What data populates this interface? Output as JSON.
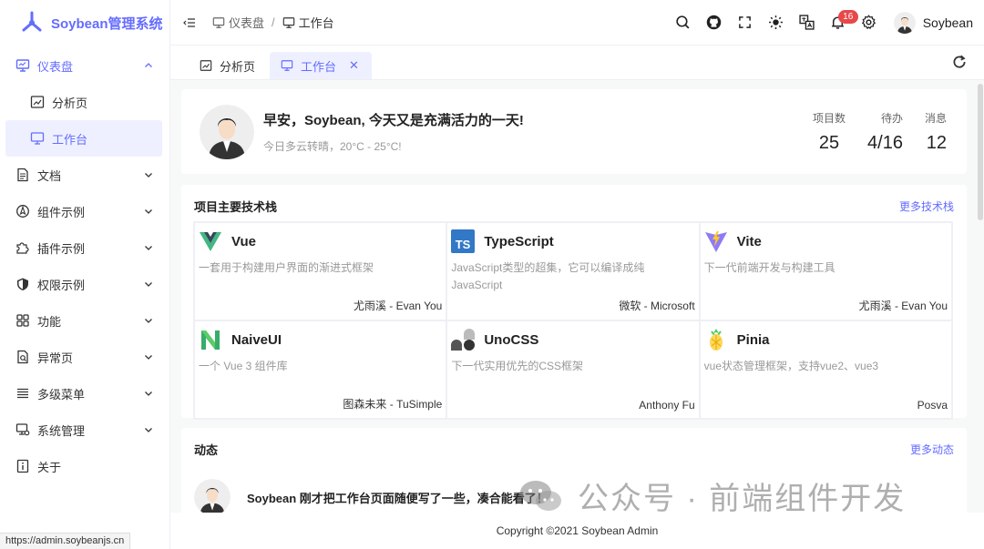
{
  "app": {
    "title": "Soybean管理系统",
    "status_url": "https://admin.soybeanjs.cn"
  },
  "sidebar": {
    "items": [
      {
        "label": "仪表盘",
        "icon": "monitor-icon"
      },
      {
        "label": "文档",
        "icon": "document-icon"
      },
      {
        "label": "组件示例",
        "icon": "compass-icon"
      },
      {
        "label": "插件示例",
        "icon": "plugin-icon"
      },
      {
        "label": "权限示例",
        "icon": "shield-icon"
      },
      {
        "label": "功能",
        "icon": "grid-icon"
      },
      {
        "label": "异常页",
        "icon": "error-page-icon"
      },
      {
        "label": "多级菜单",
        "icon": "list-icon"
      },
      {
        "label": "系统管理",
        "icon": "settings-monitor-icon"
      },
      {
        "label": "关于",
        "icon": "info-icon"
      }
    ],
    "dashboard_children": [
      {
        "label": "分析页",
        "icon": "chart-icon"
      },
      {
        "label": "工作台",
        "icon": "monitor-icon"
      }
    ]
  },
  "header": {
    "breadcrumb": [
      "仪表盘",
      "工作台"
    ],
    "notification_count": "16",
    "username": "Soybean"
  },
  "tabs": [
    {
      "label": "分析页"
    },
    {
      "label": "工作台"
    }
  ],
  "welcome": {
    "greeting": "早安，Soybean, 今天又是充满活力的一天!",
    "weather": "今日多云转晴，20°C - 25°C!",
    "stats": [
      {
        "label": "项目数",
        "value": "25"
      },
      {
        "label": "待办",
        "value": "4/16"
      },
      {
        "label": "消息",
        "value": "12"
      }
    ]
  },
  "tech": {
    "title": "项目主要技术栈",
    "more": "更多技术栈",
    "items": [
      {
        "name": "Vue",
        "desc": "一套用于构建用户界面的渐进式框架",
        "author": "尤雨溪 - Evan You"
      },
      {
        "name": "TypeScript",
        "desc": "JavaScript类型的超集，它可以编译成纯JavaScript",
        "author": "微软 - Microsoft"
      },
      {
        "name": "Vite",
        "desc": "下一代前端开发与构建工具",
        "author": "尤雨溪 - Evan You"
      },
      {
        "name": "NaiveUI",
        "desc": "一个 Vue 3 组件库",
        "author": "图森未来 - TuSimple"
      },
      {
        "name": "UnoCSS",
        "desc": "下一代实用优先的CSS框架",
        "author": "Anthony Fu"
      },
      {
        "name": "Pinia",
        "desc": "vue状态管理框架，支持vue2、vue3",
        "author": "Posva"
      }
    ]
  },
  "activity": {
    "title": "动态",
    "more": "更多动态",
    "first_text": "Soybean 刚才把工作台页面随便写了一些，凑合能看了！"
  },
  "footer": {
    "text": "Copyright ©2021 Soybean Admin"
  },
  "watermark": {
    "text": "公众号 · 前端组件开发"
  },
  "colors": {
    "primary": "#646cff",
    "badge": "#e84749"
  }
}
